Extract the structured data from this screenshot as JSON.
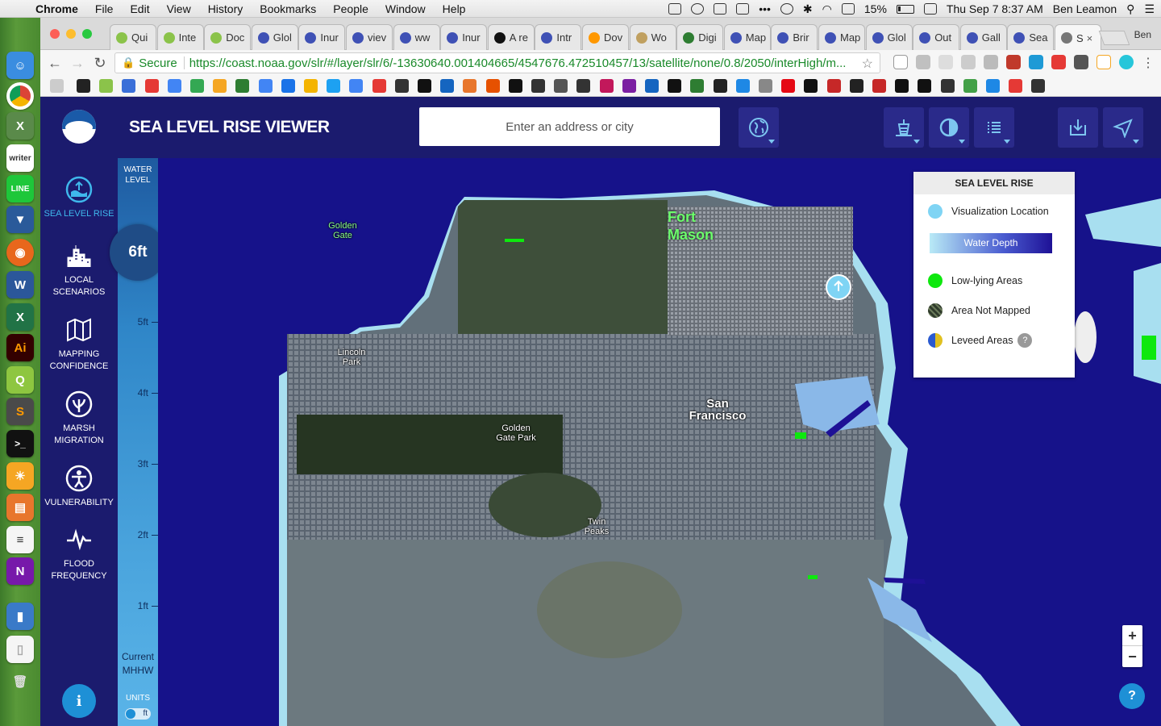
{
  "menubar": {
    "app": "Chrome",
    "items": [
      "File",
      "Edit",
      "View",
      "History",
      "Bookmarks",
      "People",
      "Window",
      "Help"
    ],
    "battery": "15%",
    "datetime": "Thu Sep 7  8:37 AM",
    "user": "Ben Leamon"
  },
  "tabs": [
    {
      "label": "Qui",
      "color": "#8bc34a"
    },
    {
      "label": "Inte",
      "color": "#8bc34a"
    },
    {
      "label": "Doc",
      "color": "#8bc34a"
    },
    {
      "label": "Glol",
      "color": "#3f51b5"
    },
    {
      "label": "Inur",
      "color": "#3f51b5"
    },
    {
      "label": "viev",
      "color": "#3f51b5"
    },
    {
      "label": "ww",
      "color": "#3f51b5"
    },
    {
      "label": "Inur",
      "color": "#3f51b5"
    },
    {
      "label": "A re",
      "color": "#111111"
    },
    {
      "label": "Intr",
      "color": "#3f51b5"
    },
    {
      "label": "Dov",
      "color": "#ff9800"
    },
    {
      "label": "Wo",
      "color": "#c0a060"
    },
    {
      "label": "Digi",
      "color": "#2e7d32"
    },
    {
      "label": "Map",
      "color": "#3f51b5"
    },
    {
      "label": "Brir",
      "color": "#3f51b5"
    },
    {
      "label": "Map",
      "color": "#3f51b5"
    },
    {
      "label": "Glol",
      "color": "#3f51b5"
    },
    {
      "label": "Out",
      "color": "#3f51b5"
    },
    {
      "label": "Gall",
      "color": "#3f51b5"
    },
    {
      "label": "Sea",
      "color": "#3f51b5"
    },
    {
      "label": "S",
      "color": "#777777",
      "active": true
    }
  ],
  "profile": "Ben",
  "omnibox": {
    "secure": "Secure",
    "url": "https://coast.noaa.gov/slr/#/layer/slr/6/-13630640.001404665/4547676.472510457/13/satellite/none/0.8/2050/interHigh/m..."
  },
  "app": {
    "title": "SEA LEVEL RISE VIEWER",
    "search_placeholder": "Enter an address or city"
  },
  "sidebar": {
    "items": [
      {
        "label": "SEA LEVEL RISE",
        "icon": "sea-level-rise-icon",
        "active": true
      },
      {
        "label": "LOCAL SCENARIOS",
        "icon": "city-icon"
      },
      {
        "label": "MAPPING CONFIDENCE",
        "icon": "map-icon"
      },
      {
        "label": "MARSH MIGRATION",
        "icon": "marsh-icon"
      },
      {
        "label": "VULNERABILITY",
        "icon": "vulnerability-icon"
      },
      {
        "label": "FLOOD FREQUENCY",
        "icon": "pulse-icon"
      }
    ]
  },
  "water_level": {
    "title": "WATER LEVEL",
    "value": "6ft",
    "ticks": [
      "5ft",
      "4ft",
      "3ft",
      "2ft",
      "1ft"
    ],
    "current": "Current MHHW",
    "units_label": "UNITS",
    "units_value": "ft"
  },
  "map_labels": {
    "golden_gate": "Golden Gate",
    "fort_mason": "Fort Mason",
    "lincoln_park": "Lincoln Park",
    "golden_gate_park": "Golden Gate Park",
    "san_francisco": "San Francisco",
    "twin_peaks": "Twin Peaks"
  },
  "legend": {
    "title": "SEA LEVEL RISE",
    "visualization_location": "Visualization Location",
    "water_depth": "Water Depth",
    "low_lying": "Low-lying Areas",
    "not_mapped": "Area Not Mapped",
    "leveed": "Leveed Areas",
    "help": "?"
  },
  "zoom": {
    "in": "+",
    "out": "−"
  },
  "help_button": "?",
  "info_button": "i",
  "colors": {
    "header_bg": "#1b1b6e",
    "accent_blue": "#1e90d6",
    "water": "#16128a",
    "low_lying_green": "#0ee80e"
  }
}
